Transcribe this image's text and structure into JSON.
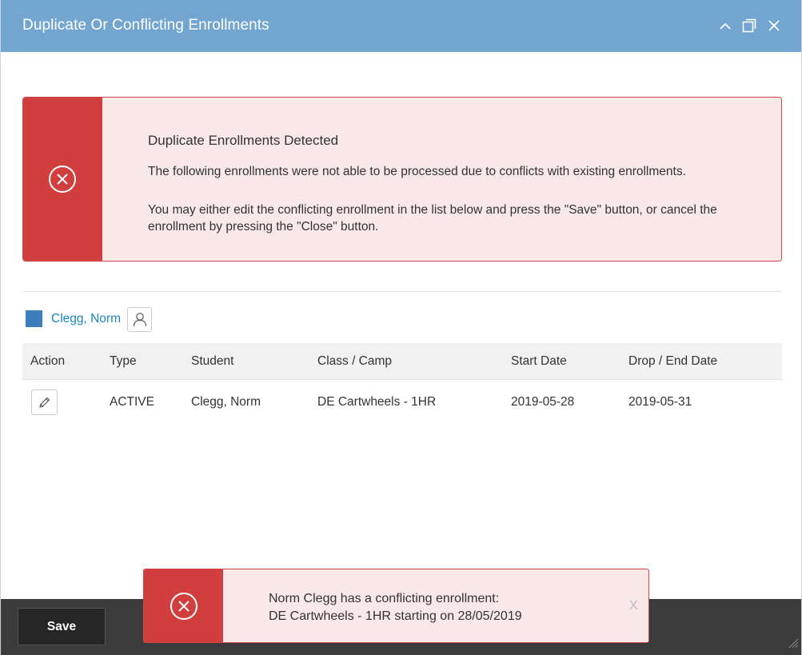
{
  "window": {
    "title": "Duplicate Or Conflicting Enrollments",
    "controls": [
      "chevron-up-icon",
      "maximize-icon",
      "close-icon"
    ]
  },
  "alert": {
    "heading": "Duplicate Enrollments Detected",
    "line1": "The following enrollments were not able to be processed due to conflicts with existing enrollments.",
    "line2": "You may either edit the conflicting enrollment in the list below and press the \"Save\" button, or cancel the enrollment by pressing the \"Close\" button.",
    "icon": "error-circle-icon"
  },
  "person": {
    "name": "Clegg, Norm",
    "swatch_color": "#3d7fbd"
  },
  "table": {
    "headers": [
      "Action",
      "Type",
      "Student",
      "Class / Camp",
      "Start Date",
      "Drop / End Date"
    ],
    "rows": [
      {
        "type": "ACTIVE",
        "student": "Clegg, Norm",
        "class_camp": "DE Cartwheels - 1HR",
        "start_date": "2019-05-28",
        "end_date": "2019-05-31"
      }
    ]
  },
  "footer": {
    "save_label": "Save"
  },
  "toast": {
    "line1": "Norm Clegg has a conflicting enrollment:",
    "line2": "DE Cartwheels - 1HR starting on 28/05/2019",
    "close_label": "X"
  },
  "colors": {
    "titlebar": "#72a5d0",
    "error": "#d03e3e",
    "error_bg": "#f9e8e8",
    "link": "#1a85c8",
    "footer": "#3b3b3b"
  }
}
